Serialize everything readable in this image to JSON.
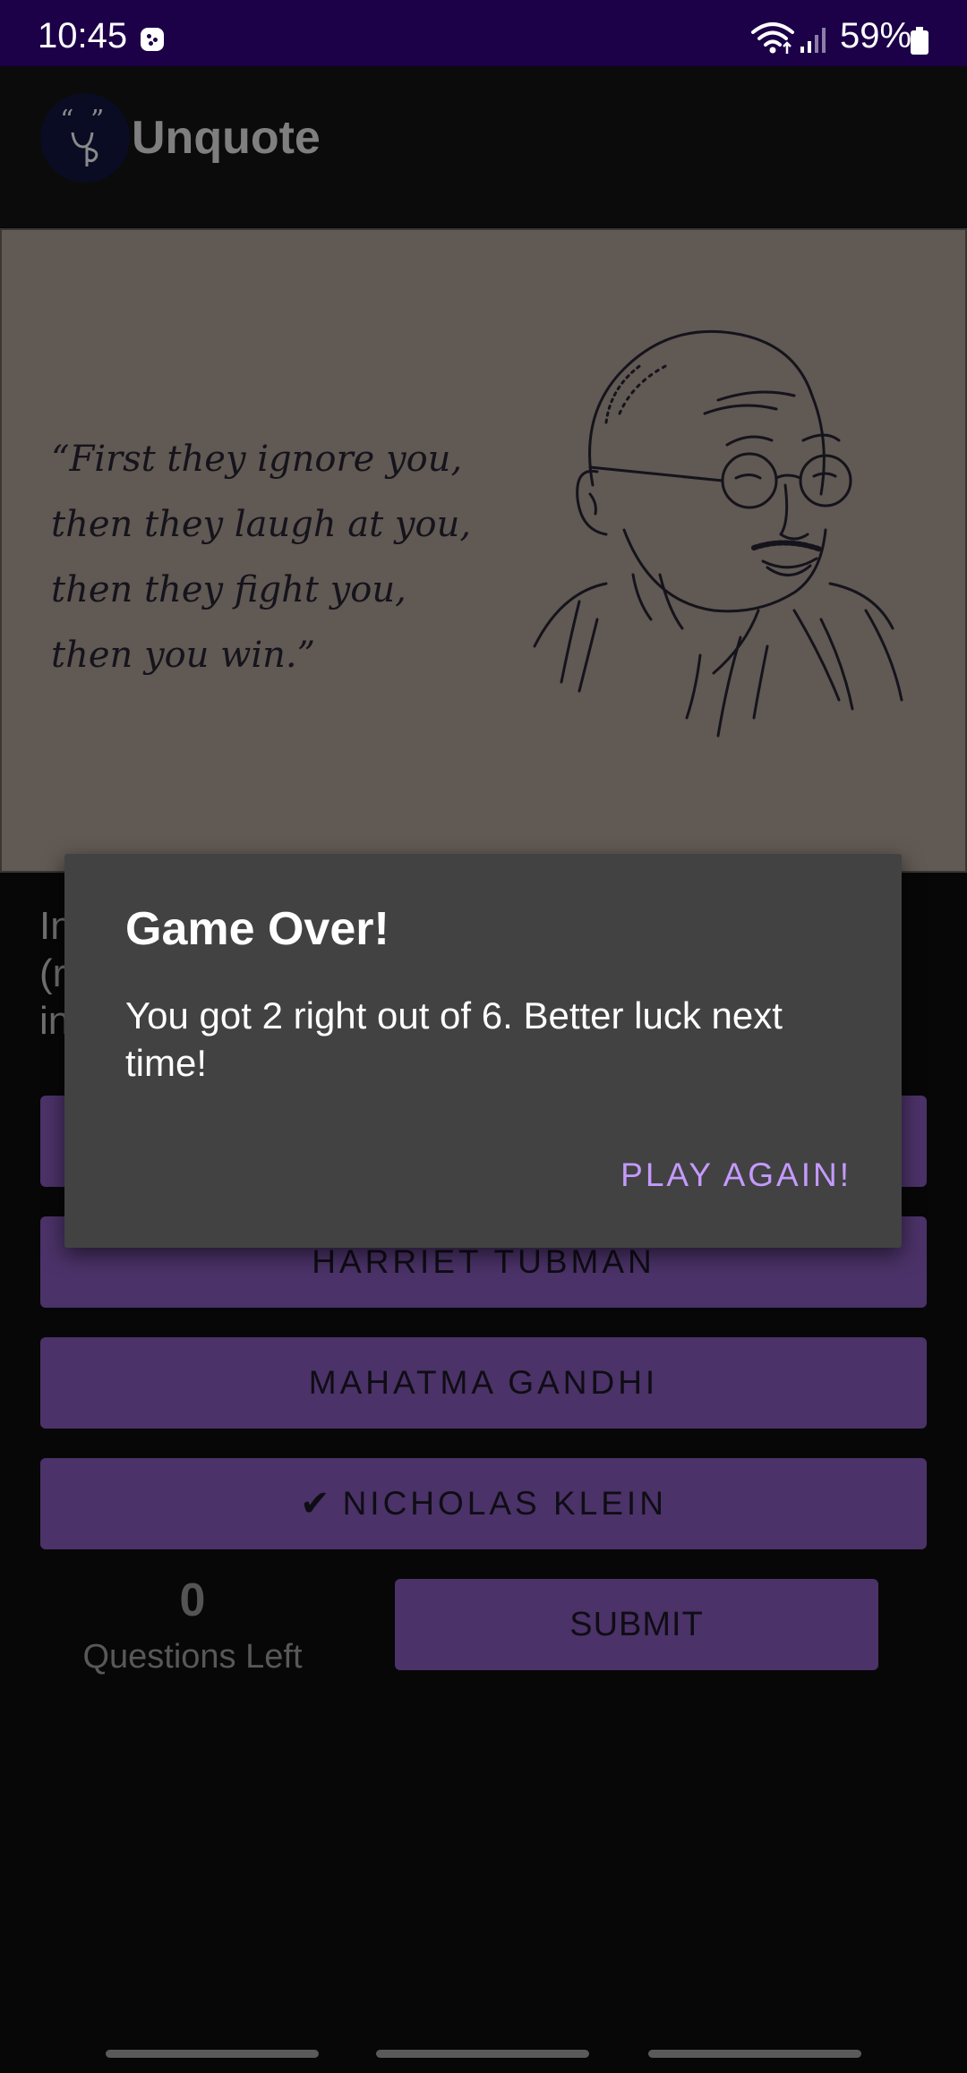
{
  "status_bar": {
    "time": "10:45",
    "battery": "59%",
    "icons": [
      "game-notification-icon",
      "wifi-icon",
      "cell-signal-icon",
      "battery-icon"
    ]
  },
  "app_bar": {
    "title": "Unquote",
    "logo_icon": "unquote-logo-icon"
  },
  "quote_image": {
    "lines": [
      "“First they ignore you,",
      "then they laugh at you,",
      "then they fight you,",
      "then you win.”"
    ]
  },
  "question": {
    "text": "In\n(r\nin"
  },
  "answers": [
    {
      "label": "",
      "checked": false
    },
    {
      "label": "HARRIET TUBMAN",
      "checked": false
    },
    {
      "label": "MAHATMA GANDHI",
      "checked": false
    },
    {
      "label": "NICHOLAS KLEIN",
      "checked": true,
      "icon": "check-icon",
      "check_glyph": "✔"
    }
  ],
  "footer": {
    "questions_left": "0",
    "questions_left_label": "Questions Left",
    "submit_label": "SUBMIT"
  },
  "dialog": {
    "title": "Game Over!",
    "message": "You got 2 right out of 6. Better luck next time!",
    "action_label": "PLAY AGAIN!",
    "action_color": "#c49aff"
  },
  "colors": {
    "status_bar": "#1c0048",
    "button": "#4b3268",
    "dialog": "#424242",
    "background": "#070707"
  }
}
